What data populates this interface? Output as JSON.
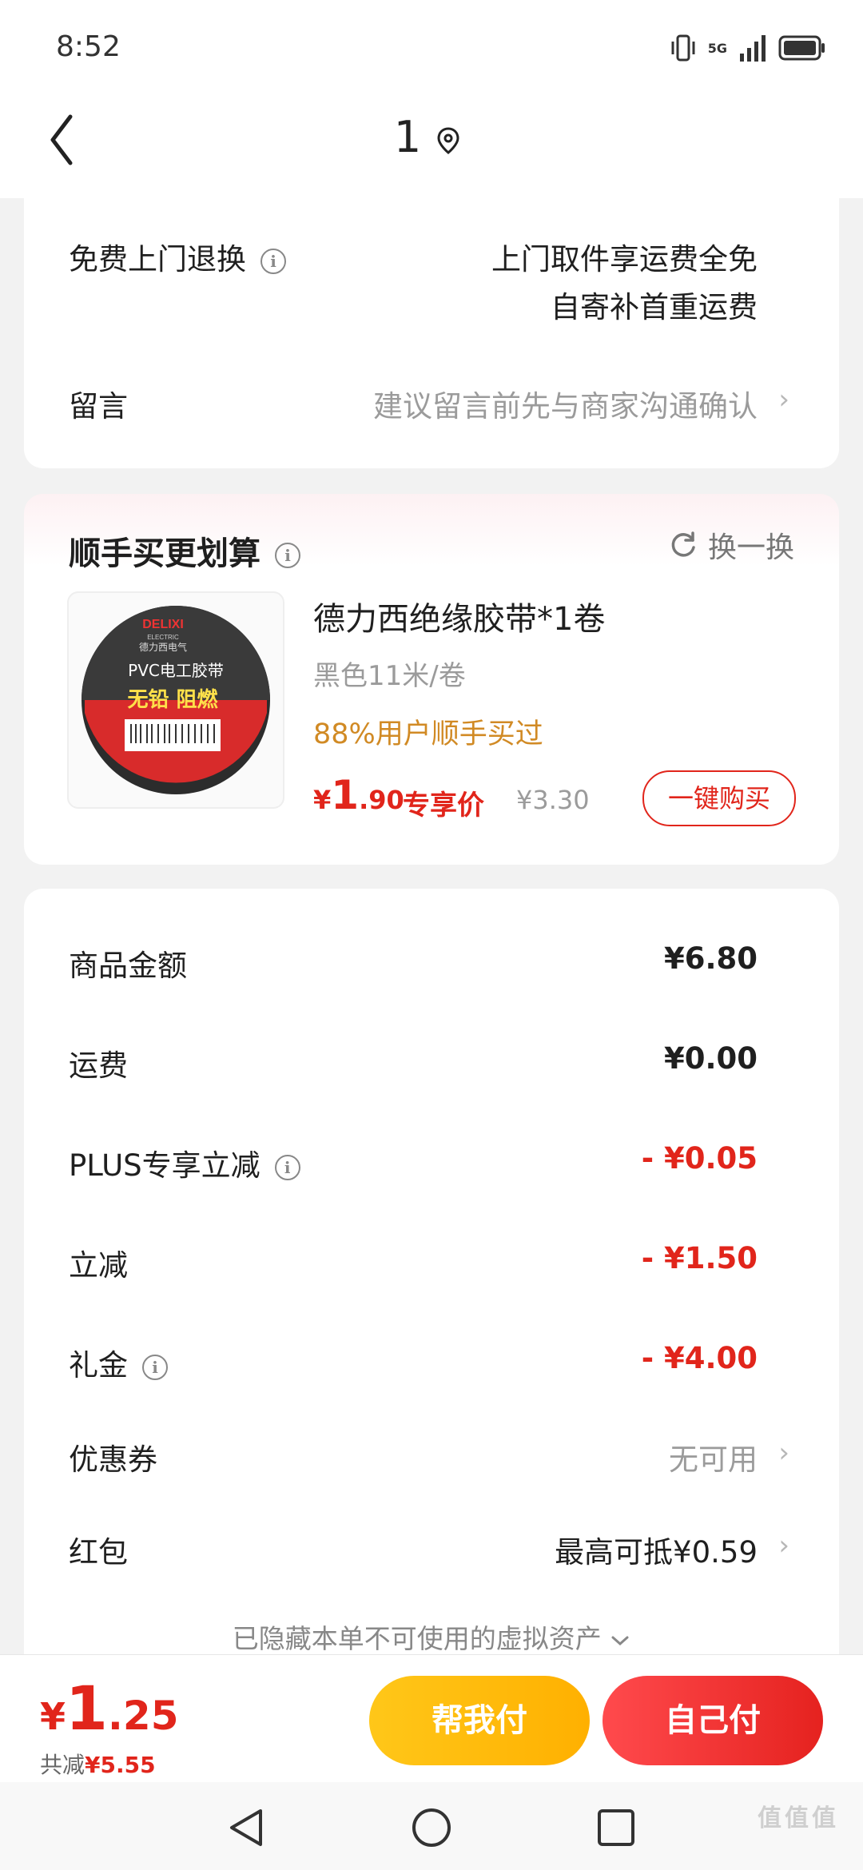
{
  "status_bar": {
    "time": "8:52",
    "network": "5G"
  },
  "header": {
    "title": "1"
  },
  "returns_card": {
    "free_return_label": "免费上门退换",
    "free_return_line1": "上门取件享运费全免",
    "free_return_line2": "自寄补首重运费",
    "message_label": "留言",
    "message_placeholder": "建议留言前先与商家沟通确认"
  },
  "upsell": {
    "title": "顺手买更划算",
    "refresh_label": "换一换",
    "product": {
      "name": "德力西绝缘胶带*1卷",
      "spec": "黑色11米/卷",
      "social_proof": "88%用户顺手买过",
      "price_symbol": "¥",
      "price_int": "1",
      "price_dec": ".90",
      "price_tag": "专享价",
      "original_price": "¥3.30",
      "buy_button": "一键购买",
      "image_text": {
        "brand": "DELIXI",
        "brand_sub": "ELECTRIC",
        "brand_cn": "德力西电气",
        "line1": "PVC电工胶带",
        "line2": "无铅 阻燃"
      }
    }
  },
  "summary": {
    "rows": [
      {
        "label": "商品金额",
        "value": "¥6.80"
      },
      {
        "label": "运费",
        "value": "¥0.00"
      },
      {
        "label": "PLUS专享立减",
        "value": "- ¥0.05"
      },
      {
        "label": "立减",
        "value": "- ¥1.50"
      },
      {
        "label": "礼金",
        "value": "- ¥4.00"
      },
      {
        "label": "优惠券",
        "value": "无可用"
      },
      {
        "label": "红包",
        "value": "最高可抵¥0.59"
      }
    ],
    "hidden_assets": "已隐藏本单不可使用的虚拟资产"
  },
  "bottom_bar": {
    "total_symbol": "¥",
    "total_int": "1",
    "total_dec": ".25",
    "saved_prefix": "共减",
    "saved_amount": "¥5.55",
    "help_pay": "帮我付",
    "self_pay": "自己付"
  },
  "watermark": "值值值",
  "colors": {
    "accent_red": "#e1251b",
    "yellow": "#ffc719",
    "orange_text": "#d18a24"
  }
}
